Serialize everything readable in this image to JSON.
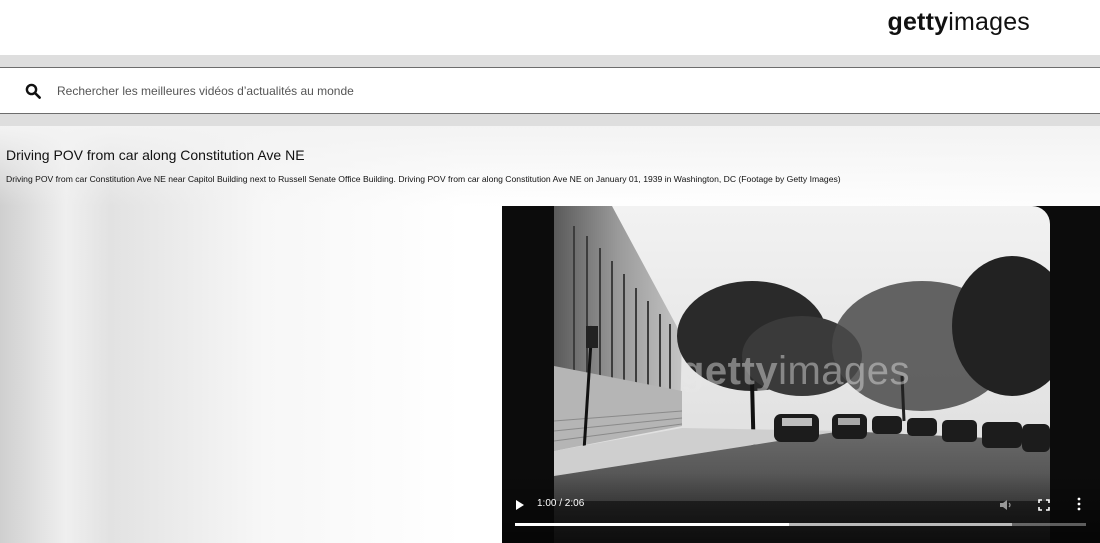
{
  "header": {
    "logo_bold": "getty",
    "logo_light": "images"
  },
  "search": {
    "icon": "search-icon",
    "placeholder": "Rechercher les meilleures vidéos d’actualités au monde",
    "value": ""
  },
  "video": {
    "title": "Driving POV from car along Constitution Ave NE",
    "description": "Driving POV from car Constitution Ave NE near Capitol Building next to Russell Senate Office Building. Driving POV from car along Constitution Ave NE on January 01, 1939 in Washington, DC (Footage by Getty Images)",
    "watermark_bold": "getty",
    "watermark_light": "images",
    "player": {
      "time": "1:00 / 2:06",
      "progress_played": 0.48,
      "progress_buffered": 0.87,
      "play_icon": "play-icon",
      "volume_icon": "volume-icon",
      "fullscreen_icon": "fullscreen-icon",
      "more_icon": "more-vertical-icon"
    }
  }
}
